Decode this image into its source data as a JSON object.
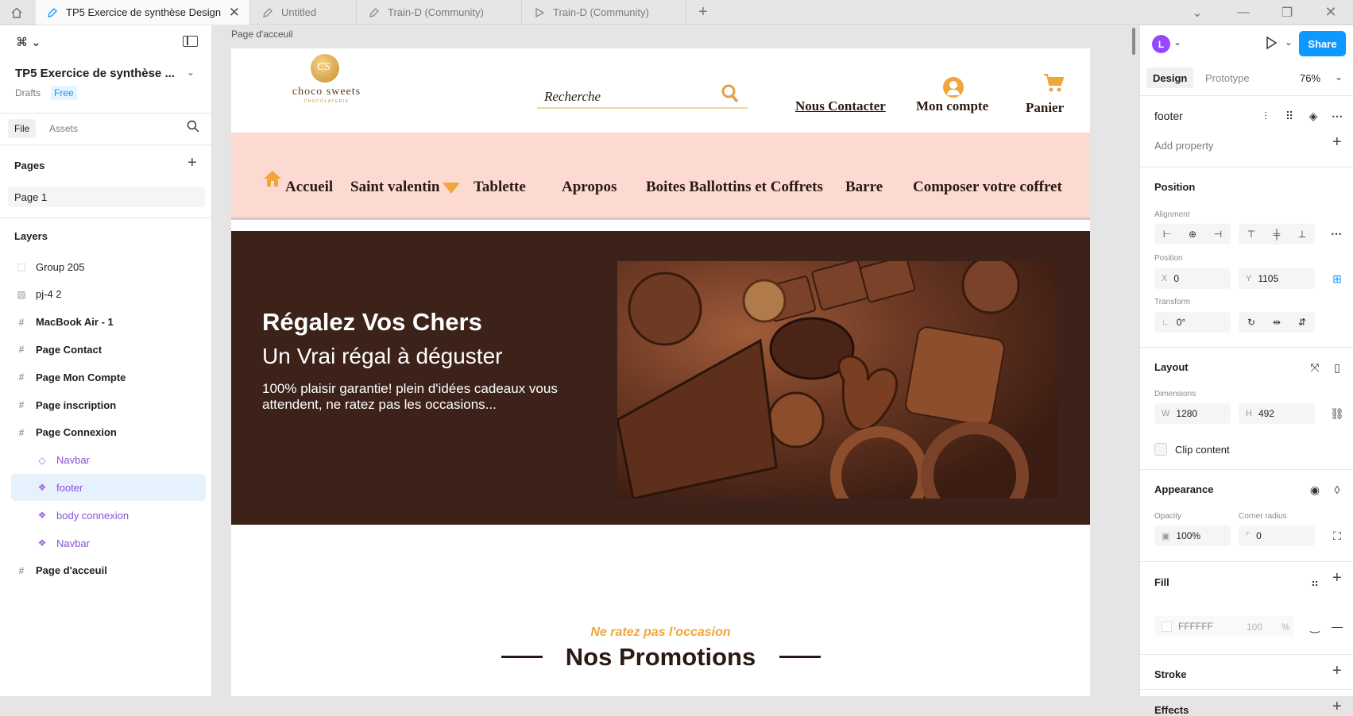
{
  "tabs": [
    {
      "label": "TP5 Exercice de synthèse Design",
      "active": true
    },
    {
      "label": "Untitled",
      "active": false
    },
    {
      "label": "Train-D (Community)",
      "active": false
    },
    {
      "label": "Train-D (Community)",
      "active": false
    }
  ],
  "left_panel": {
    "file_title": "TP5 Exercice de synthèse ...",
    "drafts_label": "Drafts",
    "plan_badge": "Free",
    "tab_file": "File",
    "tab_assets": "Assets",
    "pages_heading": "Pages",
    "page_item": "Page 1",
    "layers_heading": "Layers",
    "layers": [
      {
        "label": "Group 205",
        "icon": "group-icon",
        "kind": "group"
      },
      {
        "label": "pj-4 2",
        "icon": "image-icon",
        "kind": "image"
      },
      {
        "label": "MacBook Air - 1",
        "icon": "frame-icon",
        "kind": "frame"
      },
      {
        "label": "Page Contact",
        "icon": "frame-icon",
        "kind": "frame"
      },
      {
        "label": "Page Mon Compte",
        "icon": "frame-icon",
        "kind": "frame"
      },
      {
        "label": "Page inscription",
        "icon": "frame-icon",
        "kind": "frame"
      },
      {
        "label": "Page Connexion",
        "icon": "frame-icon",
        "kind": "frame"
      },
      {
        "label": "Navbar",
        "icon": "component-instance-icon",
        "kind": "child"
      },
      {
        "label": "footer",
        "icon": "component-icon",
        "kind": "child-selected"
      },
      {
        "label": "body connexion",
        "icon": "component-icon",
        "kind": "child"
      },
      {
        "label": "Navbar",
        "icon": "component-icon",
        "kind": "child"
      },
      {
        "label": "Page d'acceuil",
        "icon": "frame-icon",
        "kind": "frame"
      }
    ]
  },
  "canvas": {
    "frame_label": "Page d'acceuil",
    "site": {
      "logo_monogram": "CS",
      "logo_name": "choco sweets",
      "logo_tagline": "CHOCOLATERIE",
      "search_placeholder": "Recherche",
      "contact_link": "Nous Contacter",
      "account_link": "Mon compte",
      "cart_link": "Panier",
      "nav": [
        "Accueil",
        "Saint valentin",
        "Tablette",
        "Apropos",
        "Boites Ballottins et Coffrets",
        "Barre",
        "Composer votre coffret"
      ],
      "hero_title": "Régalez Vos Chers",
      "hero_subtitle": "Un Vrai régal à déguster",
      "hero_text": "100% plaisir garantie! plein d'idées cadeaux vous attendent, ne ratez pas les occasions...",
      "promo_kicker": "Ne ratez pas l'occasion",
      "promo_title": "Nos Promotions"
    },
    "colors": {
      "nav_bg": "#fcd9d1",
      "hero_bg": "#3d221a",
      "gold": "#e2a046",
      "dark_text": "#2b1a14"
    }
  },
  "right_panel": {
    "avatar_letter": "L",
    "share_label": "Share",
    "tab_design": "Design",
    "tab_prototype": "Prototype",
    "zoom": "76%",
    "layer_name": "footer",
    "add_property": "Add property",
    "position_heading": "Position",
    "alignment_label": "Alignment",
    "position_label": "Position",
    "x_prefix": "X",
    "x_value": "0",
    "y_prefix": "Y",
    "y_value": "1105",
    "transform_label": "Transform",
    "rotation_value": "0°",
    "layout_heading": "Layout",
    "dimensions_label": "Dimensions",
    "w_prefix": "W",
    "w_value": "1280",
    "h_prefix": "H",
    "h_value": "492",
    "clip_content": "Clip content",
    "appearance_heading": "Appearance",
    "opacity_label": "Opacity",
    "opacity_value": "100%",
    "corner_radius_label": "Corner radius",
    "corner_radius_value": "0",
    "fill_heading": "Fill",
    "fill_hex": "FFFFFF",
    "fill_opacity": "100",
    "fill_percent": "%",
    "stroke_heading": "Stroke",
    "effects_heading": "Effects",
    "accent_color": "#0d99ff"
  }
}
